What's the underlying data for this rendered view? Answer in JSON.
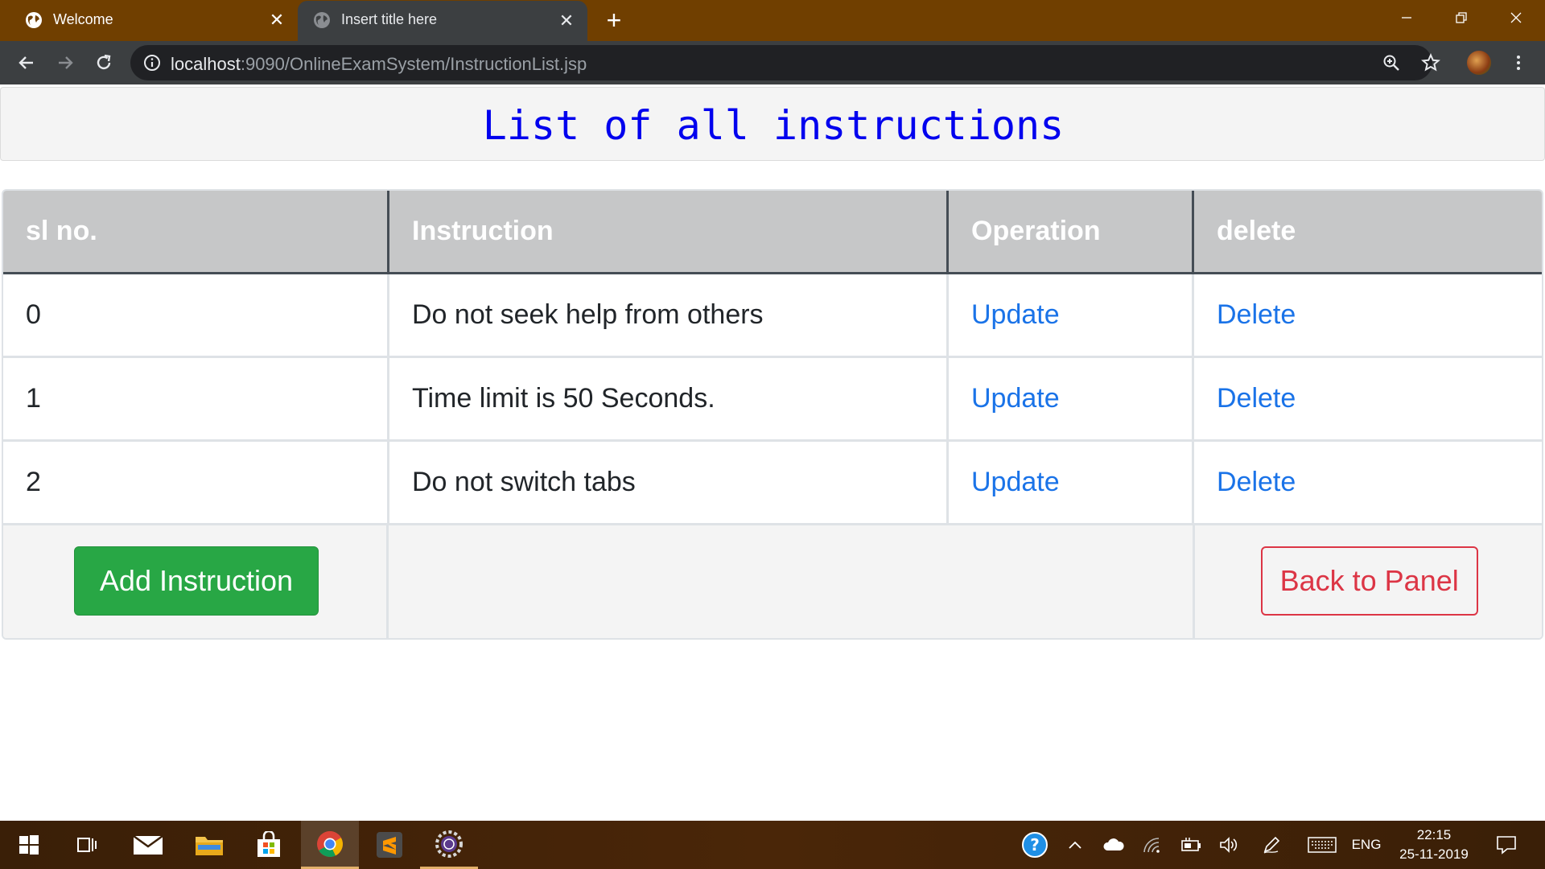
{
  "browser": {
    "tabs": [
      {
        "title": "Welcome",
        "active": false,
        "favicon": "globe-icon"
      },
      {
        "title": "Insert title here",
        "active": true,
        "favicon": "globe-icon"
      }
    ],
    "new_tab_label": "+",
    "url_host": "localhost",
    "url_rest": ":9090/OnlineExamSystem/InstructionList.jsp"
  },
  "page": {
    "title": "List of all instructions",
    "table": {
      "headers": [
        "sl no.",
        "Instruction",
        "Operation",
        "delete"
      ],
      "rows": [
        {
          "sl": "0",
          "instruction": "Do not seek help from others",
          "operation": "Update",
          "delete": "Delete"
        },
        {
          "sl": "1",
          "instruction": "Time limit is 50 Seconds.",
          "operation": "Update",
          "delete": "Delete"
        },
        {
          "sl": "2",
          "instruction": "Do not switch tabs",
          "operation": "Update",
          "delete": "Delete"
        }
      ]
    },
    "add_button": "Add Instruction",
    "back_button": "Back to Panel"
  },
  "taskbar": {
    "language": "ENG",
    "time": "22:15",
    "date": "25-11-2019"
  },
  "colors": {
    "title_blue": "#0000ee",
    "link_blue": "#1a73e8",
    "success_green": "#28a745",
    "danger_red": "#dc3545",
    "header_gray": "#c6c7c8",
    "tabstrip_brown": "#703f00"
  }
}
